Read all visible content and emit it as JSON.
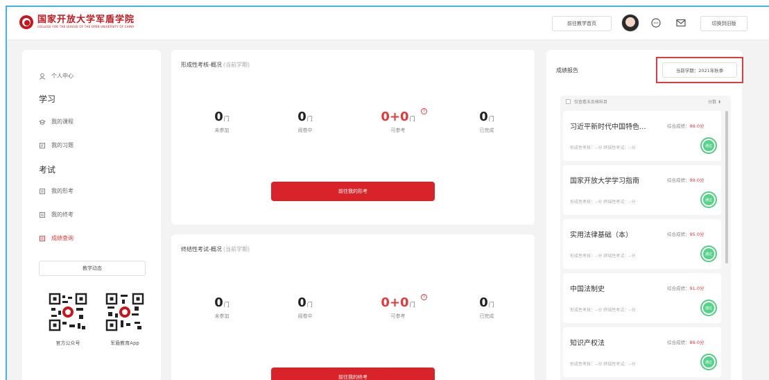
{
  "header": {
    "logo_title": "国家开放大学军盾学院",
    "logo_sub": "COLLEGE FOR THE LEAGUE OF THE OPEN UNIVERSITY OF CHINA",
    "home_button": "前往教学首页",
    "switch_button": "切换到旧版"
  },
  "sidebar": {
    "profile": "个人中心",
    "study_heading": "学习",
    "my_courses": "我的课程",
    "my_questions": "我的习题",
    "exam_heading": "考试",
    "my_formative": "我的形考",
    "my_final": "我的终考",
    "score_query": "成绩查询",
    "dynamic_button": "教学动态",
    "qr_official": "官方公众号",
    "qr_app": "军盾教育App"
  },
  "formative": {
    "title": "形成性考核-概况",
    "term": "(当前学期)",
    "stats": [
      {
        "value": "0",
        "unit": "门",
        "label": "未参加"
      },
      {
        "value": "0",
        "unit": "门",
        "label": "阅卷中"
      },
      {
        "value": "0+0",
        "unit": "门",
        "label": "可参考"
      },
      {
        "value": "0",
        "unit": "门",
        "label": "已完成"
      }
    ],
    "button": "前往我的形考"
  },
  "final": {
    "title": "终结性考试-概况",
    "term": "(当前学期)",
    "stats": [
      {
        "value": "0",
        "unit": "门",
        "label": "未参加"
      },
      {
        "value": "0",
        "unit": "门",
        "label": "阅卷中"
      },
      {
        "value": "0+0",
        "unit": "门",
        "label": "可参考"
      },
      {
        "value": "0",
        "unit": "门",
        "label": "已完成"
      }
    ],
    "button": "前往我的终考"
  },
  "report": {
    "title": "成绩报告",
    "term_selector": "当前学期：2021年秋季",
    "filter_label": "仅查看未及格科目",
    "sort_label": "分数 ⬍",
    "courses": [
      {
        "name": "习近平新时代中国特色...",
        "overall_label": "综合成绩：",
        "score": "99.0分",
        "detail": "形成性考核：--分  终结性考试：--分",
        "badge": "通过"
      },
      {
        "name": "国家开放大学学习指南",
        "overall_label": "综合成绩：",
        "score": "99.0分",
        "detail": "形成性考核：--分  终结性考试：--分",
        "badge": "通过"
      },
      {
        "name": "实用法律基础（本）",
        "overall_label": "综合成绩：",
        "score": "95.0分",
        "detail": "形成性考核：--分  终结性考试：--分",
        "badge": "通过"
      },
      {
        "name": "中国法制史",
        "overall_label": "综合成绩：",
        "score": "91.0分",
        "detail": "形成性考核：--分  终结性考试：--分",
        "badge": "通过"
      },
      {
        "name": "知识产权法",
        "overall_label": "综合成绩：",
        "score": "89.0分",
        "detail": "形成性考核：--分  终结性考试：--分",
        "badge": "通过"
      }
    ]
  },
  "colors": {
    "brand_red": "#c8161d",
    "accent_red": "#d9232a",
    "pass_green": "#4fcf80"
  }
}
